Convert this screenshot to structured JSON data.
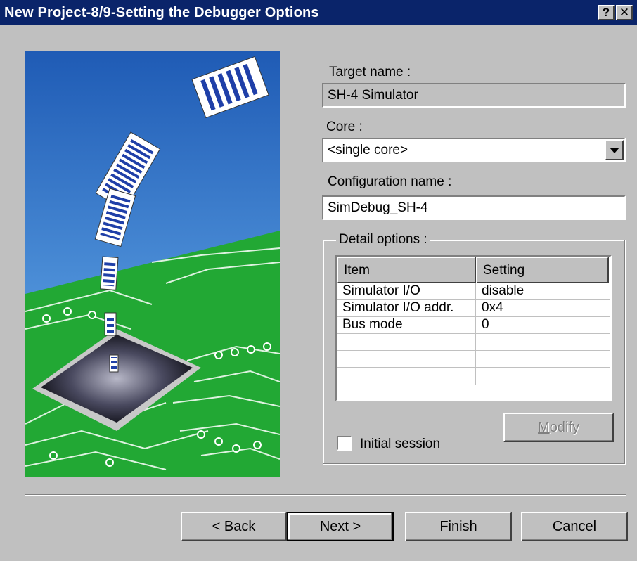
{
  "window": {
    "title": "New Project-8/9-Setting the Debugger Options",
    "help_glyph": "?",
    "close_glyph": "✕"
  },
  "form": {
    "target_label": "Target name :",
    "target_value": "SH-4 Simulator",
    "core_label": "Core :",
    "core_value": "<single core>",
    "config_label": "Configuration name :",
    "config_value": "SimDebug_SH-4"
  },
  "detail": {
    "legend": "Detail options :",
    "columns": [
      "Item",
      "Setting"
    ],
    "rows": [
      [
        "Simulator I/O",
        "disable"
      ],
      [
        "Simulator I/O addr.",
        "0x4"
      ],
      [
        "Bus mode",
        "0"
      ],
      [
        "",
        ""
      ],
      [
        "",
        ""
      ],
      [
        "",
        ""
      ]
    ],
    "initial_session_label": "Initial session",
    "initial_session_checked": false,
    "modify_prefix": "M",
    "modify_rest": "odify"
  },
  "buttons": {
    "back": "< Back",
    "next": "Next >",
    "finish": "Finish",
    "cancel": "Cancel"
  },
  "colors": {
    "titlebar": "#0a246a",
    "face": "#c0c0c0",
    "sky_top": "#1f5bb5",
    "sky_bottom": "#6fb7f2",
    "board": "#22a834",
    "trace": "#ffffff",
    "document_stripes": "#1f3fa8"
  }
}
